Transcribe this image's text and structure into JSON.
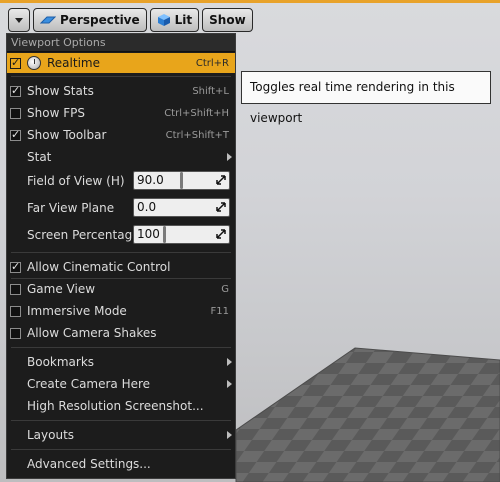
{
  "toolbar": {
    "perspective_label": "Perspective",
    "lit_label": "Lit",
    "show_label": "Show"
  },
  "menu": {
    "header": "Viewport Options",
    "items": {
      "realtime": {
        "label": "Realtime",
        "shortcut": "Ctrl+R",
        "checked": true
      },
      "show_stats": {
        "label": "Show Stats",
        "shortcut": "Shift+L",
        "checked": true
      },
      "show_fps": {
        "label": "Show FPS",
        "shortcut": "Ctrl+Shift+H",
        "checked": false
      },
      "show_toolbar": {
        "label": "Show Toolbar",
        "shortcut": "Ctrl+Shift+T",
        "checked": true
      },
      "stat": {
        "label": "Stat"
      },
      "fov": {
        "label": "Field of View (H)",
        "value": "90.0"
      },
      "far_view": {
        "label": "Far View Plane",
        "value": "0.0"
      },
      "screen_pct": {
        "label": "Screen Percentage",
        "value": "100"
      },
      "cinematic": {
        "label": "Allow Cinematic Control",
        "checked": true
      },
      "game_view": {
        "label": "Game View",
        "shortcut": "G",
        "checked": false
      },
      "immersive": {
        "label": "Immersive Mode",
        "shortcut": "F11",
        "checked": false
      },
      "camera_shakes": {
        "label": "Allow Camera Shakes",
        "checked": false
      },
      "bookmarks": {
        "label": "Bookmarks"
      },
      "create_camera": {
        "label": "Create Camera Here"
      },
      "hires": {
        "label": "High Resolution Screenshot..."
      },
      "layouts": {
        "label": "Layouts"
      },
      "advanced": {
        "label": "Advanced Settings..."
      }
    }
  },
  "tooltip": {
    "text": "Toggles real time rendering in this viewport"
  },
  "colors": {
    "highlight": "#e8a51b",
    "menu_bg": "#1c1c1c",
    "viewport_border": "#e8a22a"
  }
}
